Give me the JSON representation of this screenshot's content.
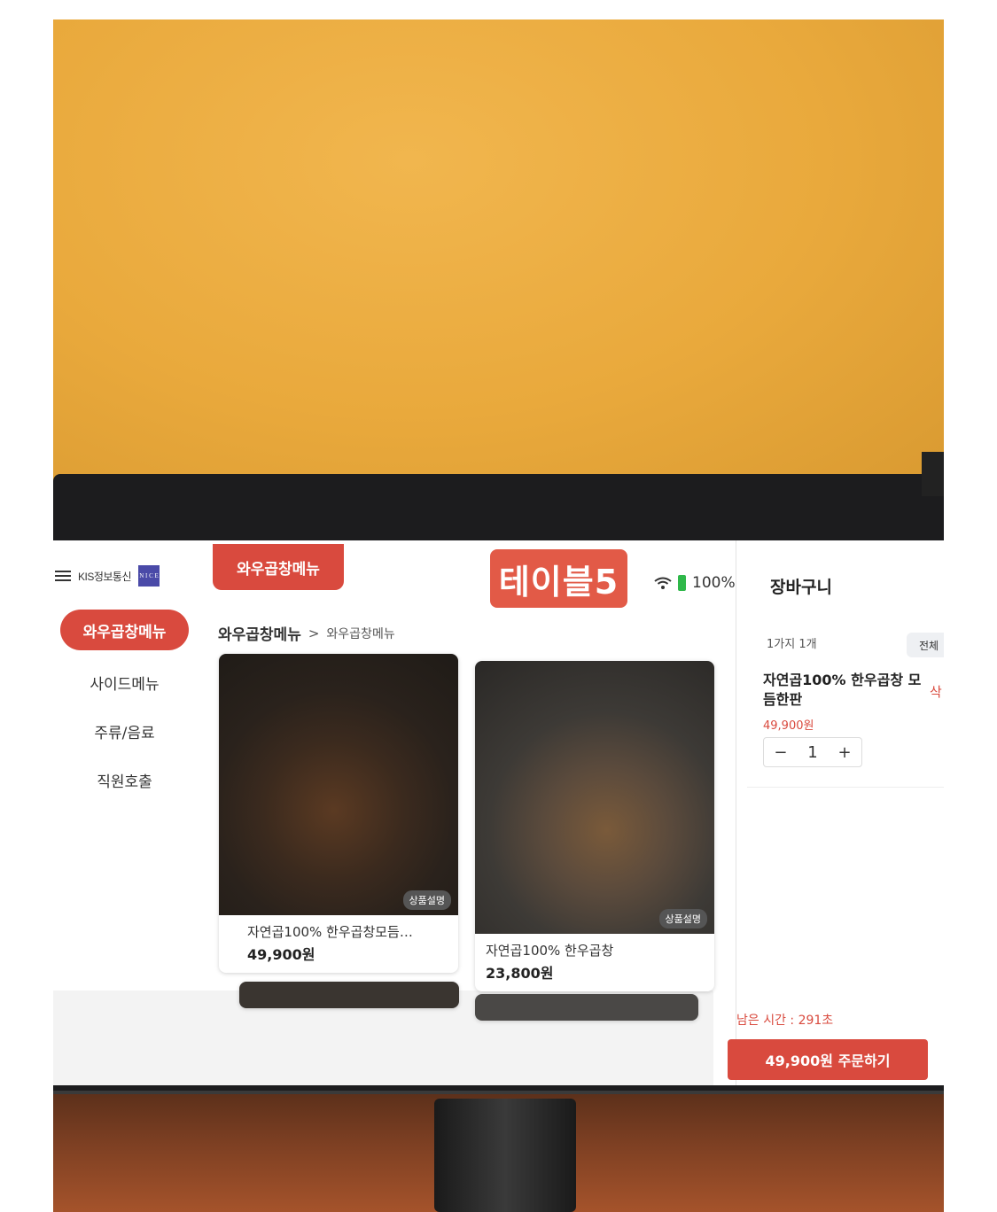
{
  "brand": {
    "name": "KIS정보통신",
    "logo_text": "N I C E"
  },
  "sidebar": {
    "items": [
      {
        "label": "와우곱창메뉴",
        "active": true
      },
      {
        "label": "사이드메뉴",
        "active": false
      },
      {
        "label": "주류/음료",
        "active": false
      },
      {
        "label": "직원호출",
        "active": false
      }
    ]
  },
  "header": {
    "category_tab": "와우곱창메뉴",
    "table_label": "테이블5",
    "battery": "100%"
  },
  "breadcrumb": {
    "main": "와우곱창메뉴",
    "separator": ">",
    "sub": "와우곱창메뉴"
  },
  "products": [
    {
      "name": "자연곱100% 한우곱창모듬…",
      "price": "49,900원",
      "badge": "상품설명"
    },
    {
      "name": "자연곱100% 한우곱창",
      "price": "23,800원",
      "badge": "상품설명"
    }
  ],
  "cart": {
    "title": "장바구니",
    "count": "1가지 1개",
    "all_label": "전체",
    "item": {
      "name": "자연곱100% 한우곱창 모듬한판",
      "price": "49,900원",
      "delete_label": "삭",
      "minus": "−",
      "qty": "1",
      "plus": "+"
    },
    "remaining": "남은 시간 : 291초",
    "order_button": "49,900원 주문하기"
  },
  "colors": {
    "accent": "#d94a3e",
    "battery": "#2fb84a"
  },
  "icons": [
    "menu-icon",
    "wifi-icon",
    "battery-icon"
  ]
}
